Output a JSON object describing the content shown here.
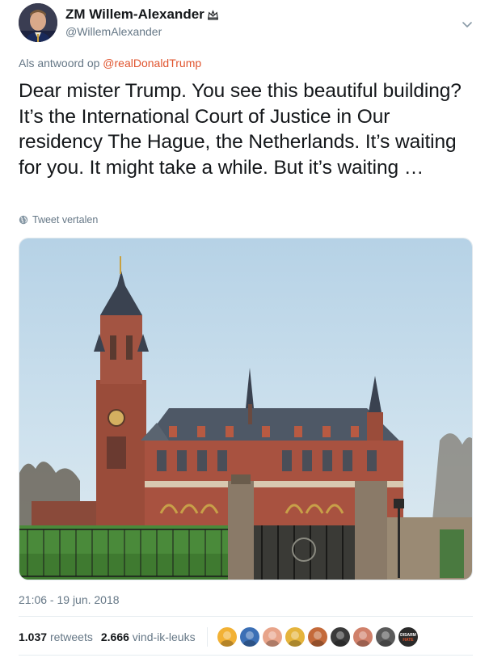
{
  "tweet": {
    "author": {
      "display_name": "ZM Willem-Alexander",
      "handle": "@WillemAlexander",
      "verified_icon": "crown-icon"
    },
    "reply_prefix": "Als antwoord op",
    "reply_to": "@realDonaldTrump",
    "text": "Dear mister Trump. You see this beautiful building? It’s the International Court of Justice in Our residency The Hague, the Netherlands. It’s waiting for you. It might take a while. But it’s waiting …",
    "translate_label": "Tweet vertalen",
    "timestamp": "21:06 - 19 jun. 2018",
    "retweets_count": "1.037",
    "retweets_label": "retweets",
    "likes_count": "2.666",
    "likes_label": "vind-ik-leuks",
    "liker_avatars": [
      {
        "name": "liker-avatar-1",
        "color": "#f2b134"
      },
      {
        "name": "liker-avatar-2",
        "color": "#3b6fb5"
      },
      {
        "name": "liker-avatar-3",
        "color": "#e8a48a"
      },
      {
        "name": "liker-avatar-4",
        "color": "#e5b43c"
      },
      {
        "name": "liker-avatar-5",
        "color": "#c46a3a"
      },
      {
        "name": "liker-avatar-6",
        "color": "#3a3a3a"
      },
      {
        "name": "liker-avatar-7",
        "color": "#d0806a"
      },
      {
        "name": "liker-avatar-8",
        "color": "#5a5a5a"
      },
      {
        "name": "liker-avatar-9",
        "color": "#2a2a2a"
      }
    ],
    "liker_badge_text": "DISARM HATE"
  },
  "colors": {
    "mention": "#e0542e",
    "secondary_text": "#657786",
    "primary_text": "#14171a"
  }
}
